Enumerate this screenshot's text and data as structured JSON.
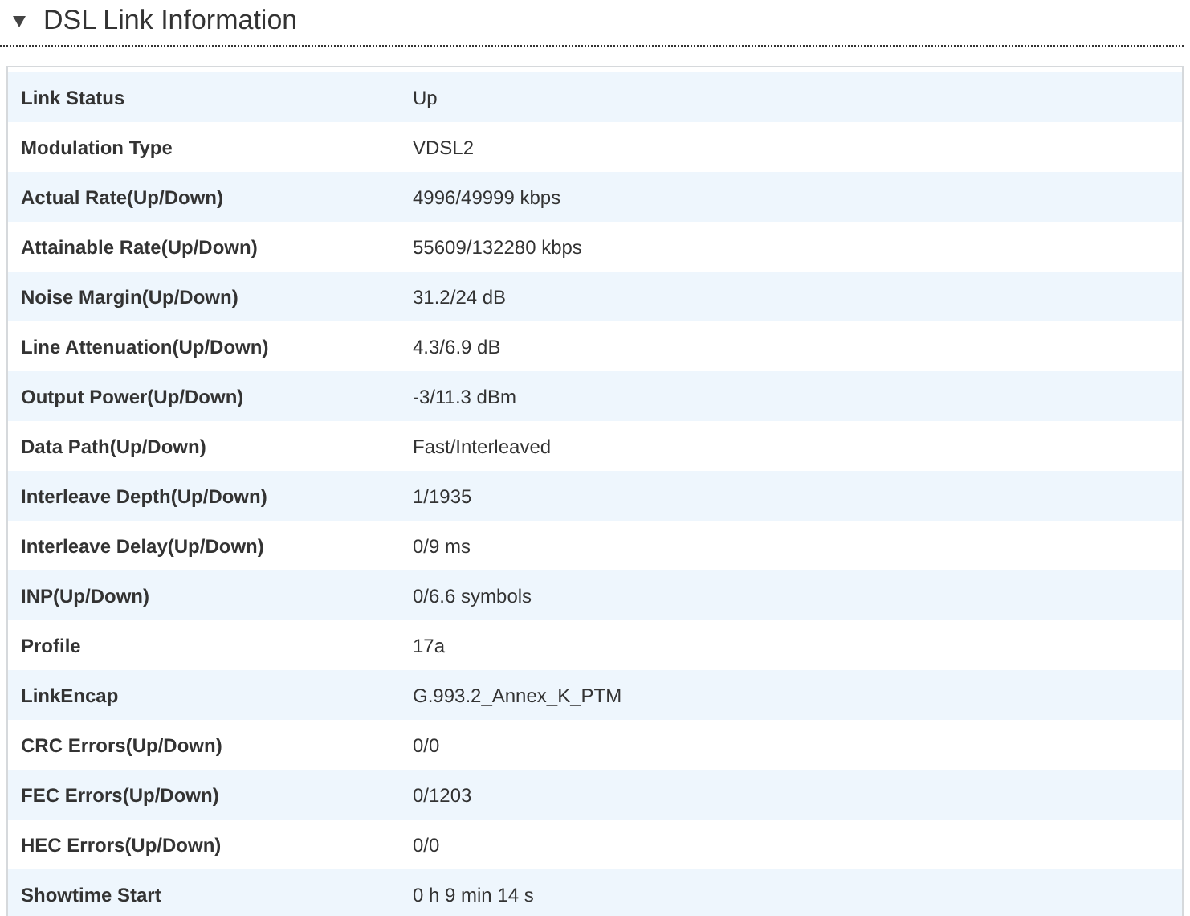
{
  "section": {
    "title": "DSL Link Information",
    "expanded": true
  },
  "rows": [
    {
      "label": "Link Status",
      "value": "Up"
    },
    {
      "label": "Modulation Type",
      "value": "VDSL2"
    },
    {
      "label": "Actual Rate(Up/Down)",
      "value": "4996/49999 kbps"
    },
    {
      "label": "Attainable Rate(Up/Down)",
      "value": "55609/132280 kbps"
    },
    {
      "label": "Noise Margin(Up/Down)",
      "value": "31.2/24 dB"
    },
    {
      "label": "Line Attenuation(Up/Down)",
      "value": "4.3/6.9 dB"
    },
    {
      "label": "Output Power(Up/Down)",
      "value": "-3/11.3 dBm"
    },
    {
      "label": "Data Path(Up/Down)",
      "value": "Fast/Interleaved"
    },
    {
      "label": "Interleave Depth(Up/Down)",
      "value": "1/1935"
    },
    {
      "label": "Interleave Delay(Up/Down)",
      "value": "0/9 ms"
    },
    {
      "label": "INP(Up/Down)",
      "value": "0/6.6 symbols"
    },
    {
      "label": "Profile",
      "value": "17a"
    },
    {
      "label": "LinkEncap",
      "value": "G.993.2_Annex_K_PTM"
    },
    {
      "label": "CRC Errors(Up/Down)",
      "value": "0/0"
    },
    {
      "label": "FEC Errors(Up/Down)",
      "value": "0/1203"
    },
    {
      "label": "HEC Errors(Up/Down)",
      "value": "0/0"
    },
    {
      "label": "Showtime Start",
      "value": "0 h 9 min 14 s"
    }
  ]
}
